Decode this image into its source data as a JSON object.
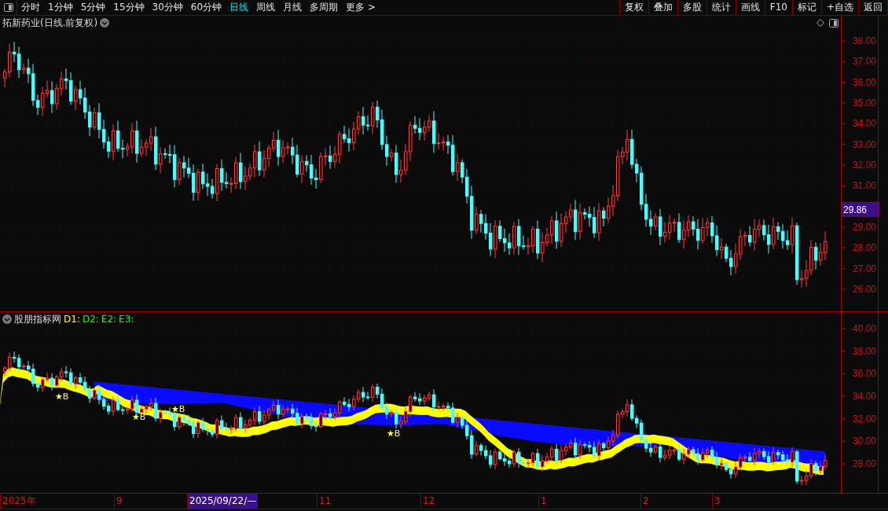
{
  "toolbar": {
    "periods": [
      {
        "label": "分时",
        "selected": false
      },
      {
        "label": "1分钟",
        "selected": false
      },
      {
        "label": "5分钟",
        "selected": false
      },
      {
        "label": "15分钟",
        "selected": false
      },
      {
        "label": "30分钟",
        "selected": false
      },
      {
        "label": "60分钟",
        "selected": false
      },
      {
        "label": "日线",
        "selected": true
      },
      {
        "label": "周线",
        "selected": false
      },
      {
        "label": "月线",
        "selected": false
      },
      {
        "label": "多周期",
        "selected": false
      },
      {
        "label": "更多 >",
        "selected": false
      }
    ],
    "buttons": [
      "复权",
      "叠加",
      "多股",
      "统计",
      "画线",
      "F10",
      "标记",
      "+自选",
      "返回"
    ]
  },
  "main_chart": {
    "title": "拓新药业(日线.前复权)",
    "price_ticks": [
      "38.00",
      "37.00",
      "36.00",
      "35.00",
      "34.00",
      "33.00",
      "32.00",
      "31.00",
      "29.00",
      "28.00",
      "27.00",
      "26.00"
    ],
    "current_price": "29.86"
  },
  "indicator": {
    "name": "股朋指标网",
    "legend": [
      {
        "label": "D1:",
        "color": "#ffff00"
      },
      {
        "label": "D2:",
        "color": "#00ff00"
      },
      {
        "label": "E2:",
        "color": "#00ff00"
      },
      {
        "label": "E3:",
        "color": "#00ff00"
      }
    ],
    "ticks": [
      "40.00",
      "38.00",
      "36.00",
      "34.00",
      "32.00",
      "30.00",
      "28.00"
    ],
    "signals": [
      {
        "label": "★B"
      },
      {
        "label": "★B"
      },
      {
        "label": "★B"
      },
      {
        "label": "★B"
      }
    ]
  },
  "time_axis": [
    {
      "label": "2025年",
      "highlighted": false
    },
    {
      "label": "9",
      "highlighted": false
    },
    {
      "label": "2025/09/22/—",
      "highlighted": true
    },
    {
      "label": "11",
      "highlighted": false
    },
    {
      "label": "12",
      "highlighted": false
    },
    {
      "label": "1",
      "highlighted": false
    },
    {
      "label": "2",
      "highlighted": false
    },
    {
      "label": "3",
      "highlighted": false
    }
  ]
}
